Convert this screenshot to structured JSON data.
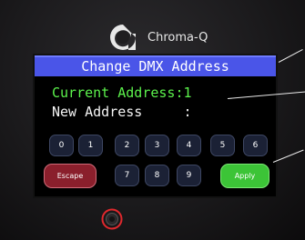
{
  "device": {
    "brand": "Chroma-Q",
    "brand_mark": "chroma-q-logo-icon"
  },
  "screen": {
    "title": "Change DMX Address",
    "current_line": "Current Address:1",
    "new_line": "New Address     :"
  },
  "keypad": {
    "top_row": [
      "0",
      "1",
      "2",
      "3",
      "4",
      "5",
      "6"
    ],
    "bottom_row": [
      "7",
      "8",
      "9"
    ],
    "escape_label": "Escape",
    "apply_label": "Apply"
  },
  "colors": {
    "title_bar": "#4a55e8",
    "current_text": "#5cf24c",
    "escape_button": "#8a1f2c",
    "apply_button": "#3cc437",
    "power_ring": "#e0282d"
  }
}
